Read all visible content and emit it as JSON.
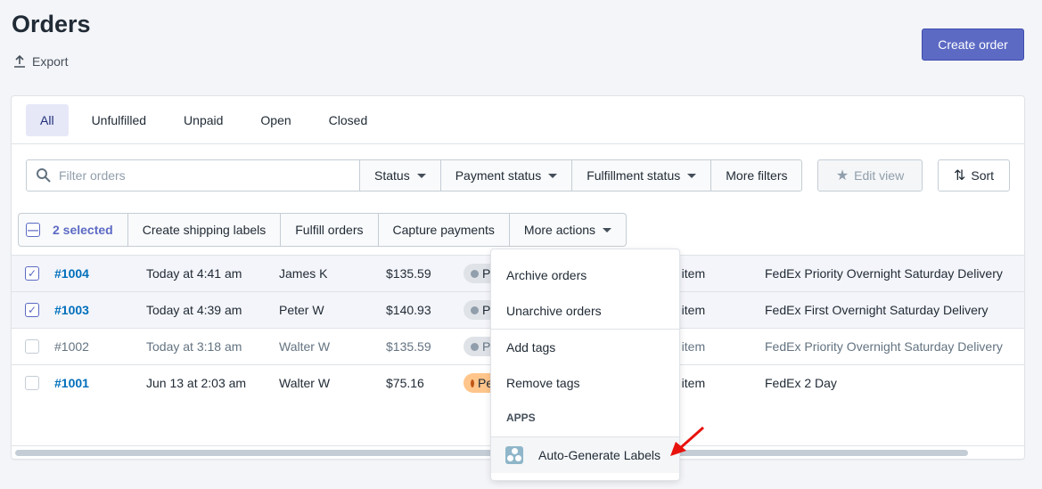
{
  "page": {
    "title": "Orders",
    "export_label": "Export",
    "create_label": "Create order"
  },
  "tabs": [
    {
      "label": "All",
      "active": true
    },
    {
      "label": "Unfulfilled"
    },
    {
      "label": "Unpaid"
    },
    {
      "label": "Open"
    },
    {
      "label": "Closed"
    }
  ],
  "filters": {
    "search_placeholder": "Filter orders",
    "buttons": [
      "Status",
      "Payment status",
      "Fulfillment status",
      "More filters"
    ],
    "edit_view": "Edit view",
    "sort": "Sort"
  },
  "bulk": {
    "selected": "2 selected",
    "actions": [
      "Create shipping labels",
      "Fulfill orders",
      "Capture payments"
    ],
    "more": "More actions"
  },
  "orders": [
    {
      "id": "#1004",
      "date": "Today at 4:41 am",
      "customer": "James K",
      "total": "$135.59",
      "payment": "Paid",
      "items": "1 item",
      "delivery": "FedEx Priority Overnight Saturday Delivery",
      "checked": true
    },
    {
      "id": "#1003",
      "date": "Today at 4:39 am",
      "customer": "Peter W",
      "total": "$140.93",
      "payment": "Paid",
      "items": "1 item",
      "delivery": "FedEx First Overnight Saturday Delivery",
      "checked": true
    },
    {
      "id": "#1002",
      "date": "Today at 3:18 am",
      "customer": "Walter W",
      "total": "$135.59",
      "payment": "Paid",
      "items": "1 item",
      "delivery": "FedEx Priority Overnight Saturday Delivery",
      "checked": false
    },
    {
      "id": "#1001",
      "date": "Jun 13 at 2:03 am",
      "customer": "Walter W",
      "total": "$75.16",
      "payment": "Pending",
      "items": "1 item",
      "delivery": "FedEx 2 Day",
      "checked": false
    }
  ],
  "menu": {
    "items": [
      "Archive orders",
      "Unarchive orders",
      "Add tags",
      "Remove tags"
    ],
    "section": "APPS",
    "app": "Auto-Generate Labels"
  },
  "colors": {
    "accent": "#5c6ac4",
    "link": "#006fbb",
    "arrow": "#e8120c"
  }
}
